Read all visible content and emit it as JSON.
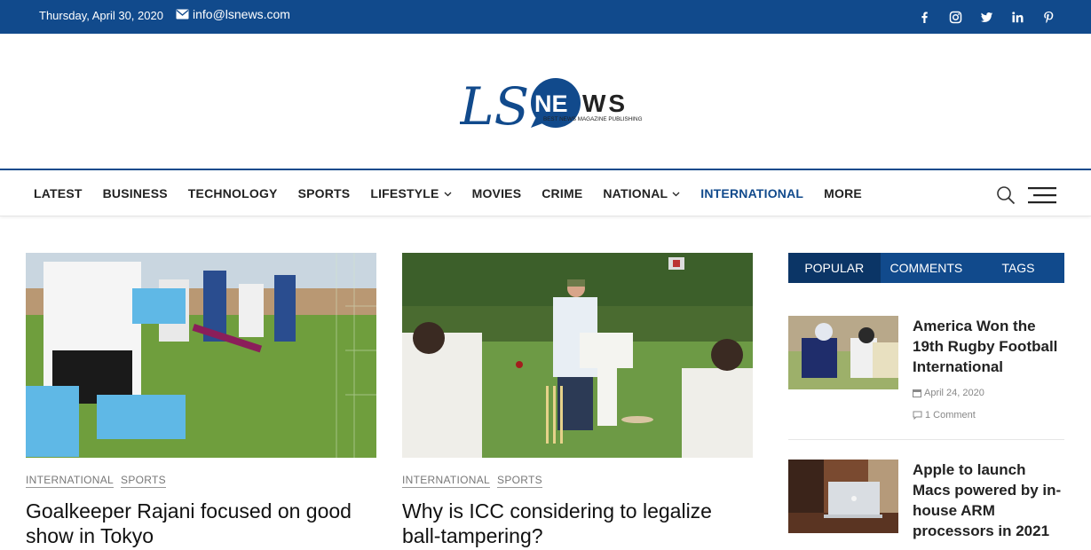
{
  "topbar": {
    "date": "Thursday, April 30, 2020",
    "email": "info@lsnews.com",
    "socials": [
      "facebook-icon",
      "instagram-icon",
      "twitter-icon",
      "linkedin-icon",
      "pinterest-icon"
    ]
  },
  "logo": {
    "ls": "LS",
    "ne": "NE",
    "ws": "WS",
    "tagline": "BEST NEWS MAGAZINE PUBLISHING"
  },
  "nav": {
    "items": [
      {
        "label": "LATEST"
      },
      {
        "label": "BUSINESS"
      },
      {
        "label": "TECHNOLOGY"
      },
      {
        "label": "SPORTS"
      },
      {
        "label": "LIFESTYLE"
      },
      {
        "label": "MOVIES"
      },
      {
        "label": "CRIME"
      },
      {
        "label": "NATIONAL"
      },
      {
        "label": "INTERNATIONAL"
      },
      {
        "label": "MORE"
      }
    ]
  },
  "articles": [
    {
      "tags": [
        "INTERNATIONAL",
        "SPORTS"
      ],
      "title": "Goalkeeper Rajani focused on good show in Tokyo"
    },
    {
      "tags": [
        "INTERNATIONAL",
        "SPORTS"
      ],
      "title": "Why is ICC considering to legalize ball-tampering?"
    }
  ],
  "sidebar": {
    "tabs": [
      "POPULAR",
      "COMMENTS",
      "TAGS"
    ],
    "items": [
      {
        "title": "America Won the 19th Rugby Football International",
        "date": "April 24, 2020",
        "comments": "1 Comment"
      },
      {
        "title": "Apple to launch Macs powered by in-house ARM processors in 2021"
      }
    ]
  },
  "colors": {
    "brand": "#114a8c",
    "brand_dark": "#0b3566"
  }
}
